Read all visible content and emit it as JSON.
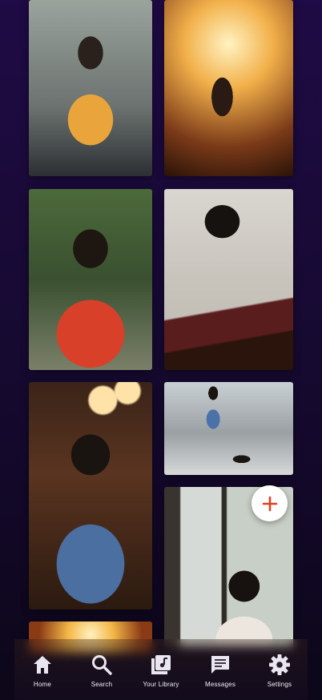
{
  "nav": {
    "items": [
      {
        "label": "Home",
        "icon": "home-icon"
      },
      {
        "label": "Search",
        "icon": "search-icon"
      },
      {
        "label": "Your Library",
        "icon": "library-icon"
      },
      {
        "label": "Messages",
        "icon": "messages-icon"
      },
      {
        "label": "Settings",
        "icon": "settings-icon"
      }
    ]
  },
  "gallery": {
    "photos": [
      {
        "subject": "woman in yellow shirt seated"
      },
      {
        "subject": "concert crowd silhouette"
      },
      {
        "subject": "woman in red shirt smiling"
      },
      {
        "subject": "woman playing guitar"
      },
      {
        "subject": "woman in denim jacket at bar"
      },
      {
        "subject": "woman walking dog"
      },
      {
        "subject": "woman at cafe window"
      },
      {
        "subject": "concert lights"
      }
    ]
  },
  "fab": {
    "icon": "plus-icon",
    "color": "#e0411f"
  },
  "colors": {
    "background": "#1a0b3a",
    "nav_label": "#f2f0f6"
  }
}
